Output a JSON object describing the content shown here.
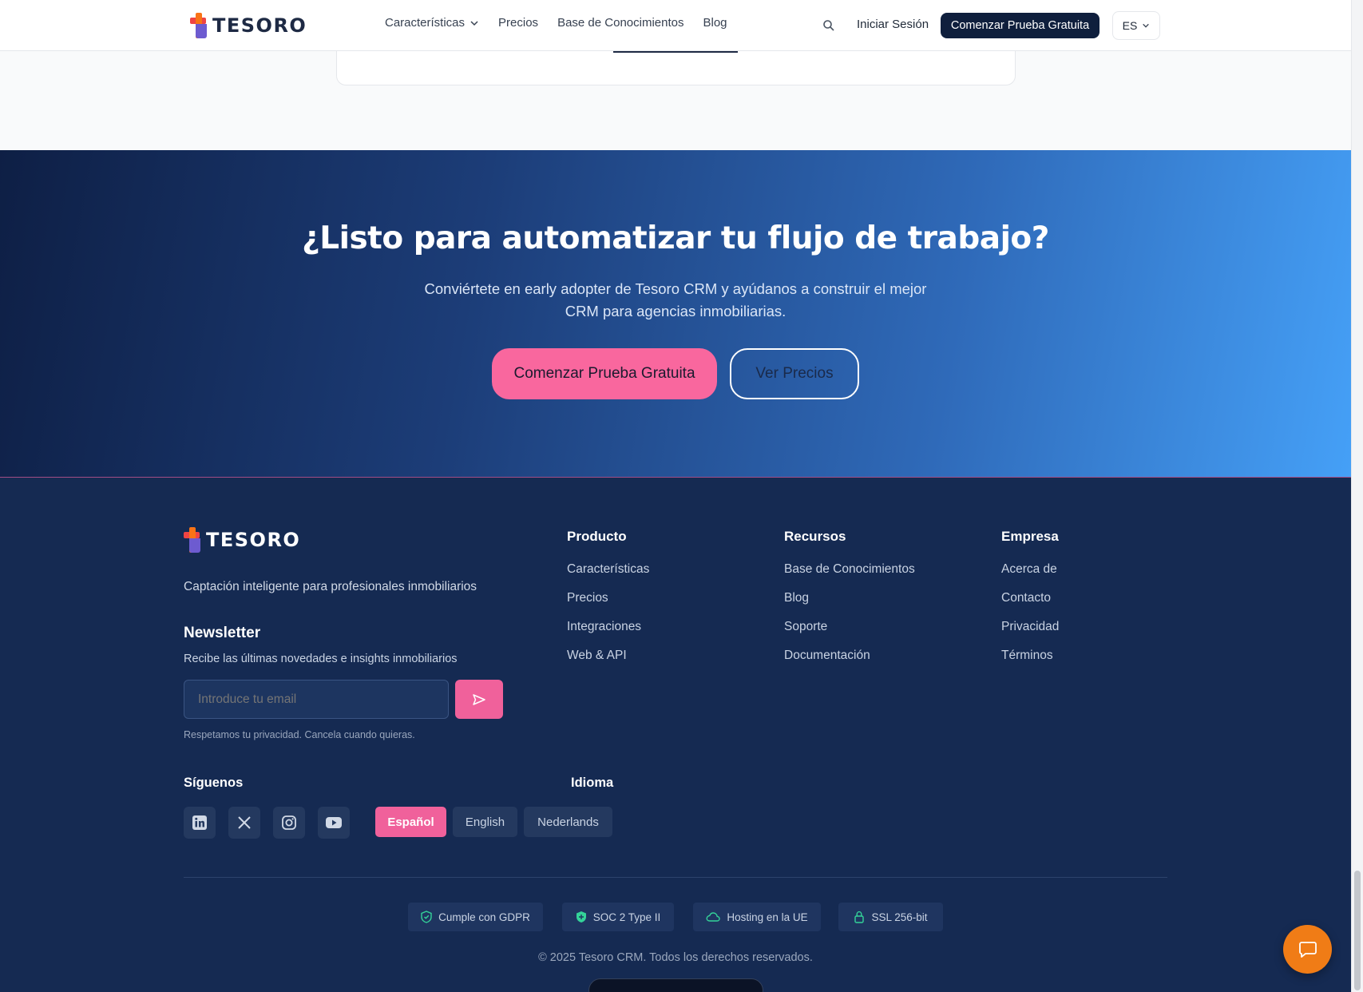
{
  "nav": {
    "brand": "TESORO",
    "links": [
      "Características",
      "Precios",
      "Base de Conocimientos",
      "Blog"
    ],
    "login": "Iniciar Sesión",
    "cta": "Comenzar Prueba Gratuita",
    "language": "ES"
  },
  "hero": {
    "title": "¿Listo para automatizar tu flujo de trabajo?",
    "subtitle": "Conviértete en early adopter de Tesoro CRM y ayúdanos a construir el mejor CRM para agencias inmobiliarias.",
    "primary_button": "Comenzar Prueba Gratuita",
    "secondary_button": "Ver Precios"
  },
  "footer": {
    "brand": "TESORO",
    "tagline": "Captación inteligente para profesionales inmobiliarios",
    "newsletter": {
      "title": "Newsletter",
      "subtitle": "Recibe las últimas novedades e insights inmobiliarios",
      "placeholder": "Introduce tu email",
      "privacy": "Respetamos tu privacidad. Cancela cuando quieras."
    },
    "columns": [
      {
        "title": "Producto",
        "links": [
          "Características",
          "Precios",
          "Integraciones",
          "Web & API"
        ]
      },
      {
        "title": "Recursos",
        "links": [
          "Base de Conocimientos",
          "Blog",
          "Soporte",
          "Documentación"
        ]
      },
      {
        "title": "Empresa",
        "links": [
          "Acerca de",
          "Contacto",
          "Privacidad",
          "Términos"
        ]
      }
    ],
    "follow_title": "Síguenos",
    "social": [
      "linkedin-icon",
      "x-icon",
      "instagram-icon",
      "youtube-icon"
    ],
    "language_title": "Idioma",
    "languages": [
      "Español",
      "English",
      "Nederlands"
    ],
    "active_language": "Español",
    "badges": [
      "Cumple con GDPR",
      "SOC 2 Type II",
      "Hosting en la UE",
      "SSL 256-bit"
    ],
    "copyright": "© 2025 Tesoro CRM. Todos los derechos reservados."
  },
  "colors": {
    "accent_pink": "#f0619b",
    "navy": "#152a52",
    "chat_orange": "#f07c16",
    "badge_green": "#34d399"
  }
}
